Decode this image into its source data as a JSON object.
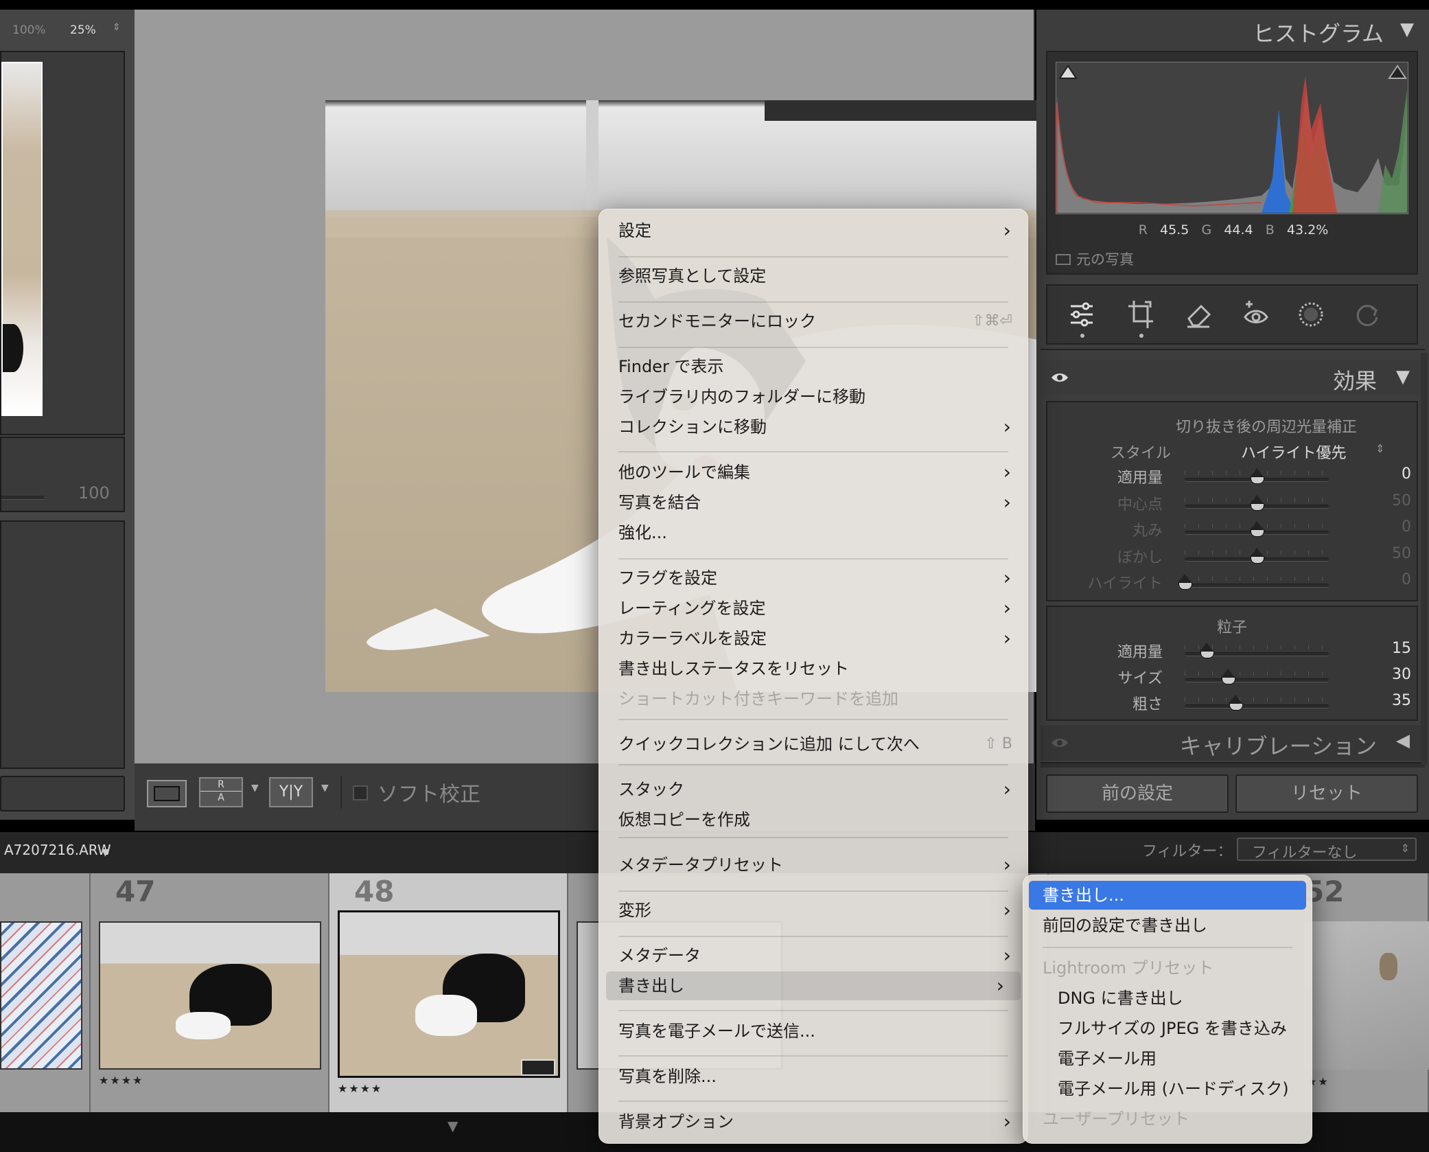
{
  "left_panel": {
    "zoom_100": "100%",
    "zoom_25": "25%",
    "slider_value": "100"
  },
  "toolbar": {
    "soft_proof_label": "ソフト校正",
    "ra_label_r": "R",
    "ra_label_a": "A",
    "yy_label": "Y|Y"
  },
  "histogram": {
    "title": "ヒストグラム",
    "r_label": "R",
    "r_value": "45.5",
    "g_label": "G",
    "g_value": "44.4",
    "b_label": "B",
    "b_value": "43.2",
    "pct": "%",
    "original_photo_label": "元の写真"
  },
  "effects": {
    "title": "効果",
    "vignette_title": "切り抜き後の周辺光量補正",
    "style_label": "スタイル",
    "style_value": "ハイライト優先",
    "vignette_sliders": [
      {
        "label": "適用量",
        "value": "0",
        "pos": 0.5,
        "active": true
      },
      {
        "label": "中心点",
        "value": "50",
        "pos": 0.5,
        "active": false
      },
      {
        "label": "丸み",
        "value": "0",
        "pos": 0.5,
        "active": false
      },
      {
        "label": "ぼかし",
        "value": "50",
        "pos": 0.5,
        "active": false
      },
      {
        "label": "ハイライト",
        "value": "0",
        "pos": 0.0,
        "active": false
      }
    ],
    "grain_title": "粒子",
    "grain_sliders": [
      {
        "label": "適用量",
        "value": "15",
        "pos": 0.15,
        "active": true
      },
      {
        "label": "サイズ",
        "value": "30",
        "pos": 0.3,
        "active": true
      },
      {
        "label": "粗さ",
        "value": "35",
        "pos": 0.35,
        "active": true
      }
    ]
  },
  "calibration": {
    "title": "キャリブレーション"
  },
  "buttons": {
    "previous": "前の設定",
    "reset": "リセット"
  },
  "filmbar": {
    "filename": "A7207216.ARW",
    "filter_label": "フィルター：",
    "filter_value": "フィルターなし"
  },
  "filmstrip": {
    "cells": [
      {
        "num": "47",
        "stars": "★★★★"
      },
      {
        "num": "48",
        "stars": "★★★★"
      },
      {
        "num": "52",
        "stars": "★★"
      }
    ]
  },
  "context_menu": {
    "items": [
      {
        "label": "設定",
        "arrow": true
      },
      {
        "label": "参照写真として設定"
      },
      {
        "label": "セカンドモニターにロック",
        "shortcut": "⇧⌘⏎"
      },
      {
        "label": "Finder で表示"
      },
      {
        "label": "ライブラリ内のフォルダーに移動"
      },
      {
        "label": "コレクションに移動",
        "arrow": true
      },
      {
        "label": "他のツールで編集",
        "arrow": true
      },
      {
        "label": "写真を結合",
        "arrow": true
      },
      {
        "label": "強化..."
      },
      {
        "label": "フラグを設定",
        "arrow": true
      },
      {
        "label": "レーティングを設定",
        "arrow": true
      },
      {
        "label": "カラーラベルを設定",
        "arrow": true
      },
      {
        "label": "書き出しステータスをリセット"
      },
      {
        "label": "ショートカット付きキーワードを追加",
        "disabled": true
      },
      {
        "label": "クイックコレクションに追加 にして次へ",
        "shortcut": "⇧ B"
      },
      {
        "label": "スタック",
        "arrow": true
      },
      {
        "label": "仮想コピーを作成"
      },
      {
        "label": "メタデータプリセット",
        "arrow": true
      },
      {
        "label": "変形",
        "arrow": true
      },
      {
        "label": "メタデータ",
        "arrow": true
      },
      {
        "label": "書き出し",
        "arrow": true,
        "highlighted": true
      },
      {
        "label": "写真を電子メールで送信..."
      },
      {
        "label": "写真を削除..."
      },
      {
        "label": "背景オプション",
        "arrow": true
      }
    ]
  },
  "submenu": {
    "items": [
      {
        "label": "書き出し...",
        "selected": true
      },
      {
        "label": "前回の設定で書き出し"
      },
      {
        "label": "Lightroom プリセット",
        "disabled": true
      },
      {
        "label": "DNG に書き出し"
      },
      {
        "label": "フルサイズの JPEG を書き込み"
      },
      {
        "label": "電子メール用"
      },
      {
        "label": "電子メール用 (ハードディスク)"
      },
      {
        "label": "ユーザープリセット",
        "disabled": true
      }
    ]
  },
  "colors": {
    "menu_bg": "#e2ded8",
    "selection_blue": "#3a78e6",
    "panel_bg": "#3d3d3d"
  }
}
